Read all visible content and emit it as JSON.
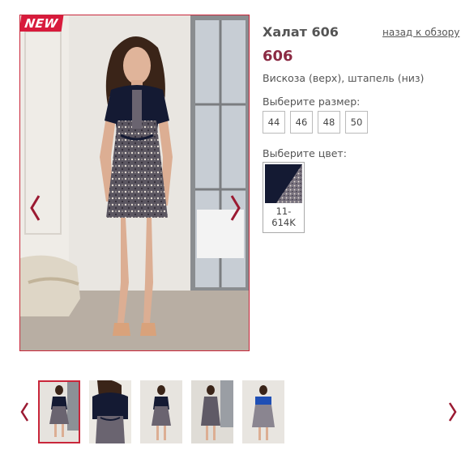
{
  "product": {
    "badge": "NEW",
    "title": "Халат 606",
    "back_link": "назад к обзору",
    "article": "606",
    "material": "Вискоза (верх), штапель (низ)",
    "size_label": "Выберите размер:",
    "sizes": [
      "44",
      "46",
      "48",
      "50"
    ],
    "color_label": "Выберите цвет:",
    "colors": [
      {
        "code_line1": "11-",
        "code_line2": "614K"
      }
    ]
  },
  "gallery": {
    "thumbnail_count": 5,
    "selected_index": 0,
    "prev_icon": "chevron-left-icon",
    "next_icon": "chevron-right-icon"
  },
  "colors": {
    "accent": "#c9263a",
    "article": "#8b2a43",
    "arrow": "#9b1a32",
    "dress_top": "#141a33"
  }
}
